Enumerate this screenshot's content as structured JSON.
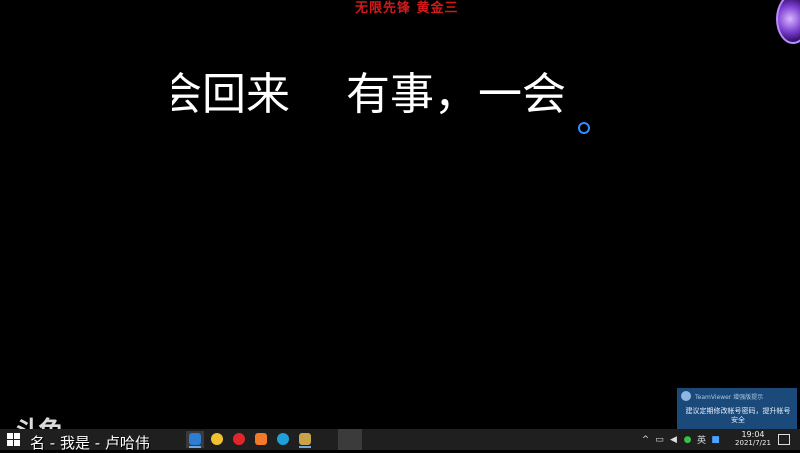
{
  "stream": {
    "top_title": "无限先锋  黄金三",
    "marquee_text": "会回来    有事，一会",
    "watermark": "斗鱼",
    "caption": "名 - 我是 - 卢哈伟"
  },
  "notification": {
    "title": "TeamViewer 增强版提示",
    "body": "建议定期修改帐号密码，提升帐号安全"
  },
  "taskbar": {
    "apps": [
      {
        "icon": "search-app-icon",
        "color": "#2d7dd2"
      },
      {
        "icon": "green-circle-app-icon",
        "color": "#f2c12e"
      },
      {
        "icon": "netease-music-icon",
        "color": "#e0262a"
      },
      {
        "icon": "orange-app-icon",
        "color": "#f07a28"
      },
      {
        "icon": "edge-browser-icon",
        "color": "#1fa0d9"
      },
      {
        "icon": "league-client-icon",
        "color": "#c8a34a"
      }
    ],
    "tray": {
      "ime": "英",
      "time": "19:04",
      "date": "2021/7/21"
    }
  }
}
